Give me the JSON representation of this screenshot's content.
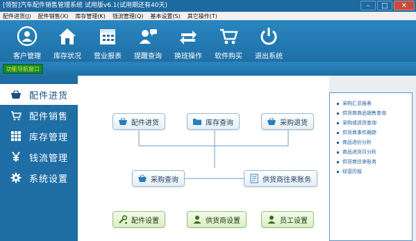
{
  "window": {
    "title": "[领智]汽车配件销售管理系统 试用版v6.1(试用期还有40天)",
    "controls": [
      "–",
      "□",
      "✕"
    ]
  },
  "menu": [
    "配件进货(J)",
    "配件销售(X)",
    "库存管理(K)",
    "钱流管理(Q)",
    "基本设置(S)",
    "其它操作(T)"
  ],
  "toolbar": [
    {
      "label": "客户管理",
      "icon": "customer-icon"
    },
    {
      "label": "库存状况",
      "icon": "home-icon"
    },
    {
      "label": "营业报表",
      "icon": "calendar-icon"
    },
    {
      "label": "提醒查询",
      "icon": "reminder-icon"
    },
    {
      "label": "换班操作",
      "icon": "swap-icon"
    },
    {
      "label": "软件购买",
      "icon": "cart-icon"
    },
    {
      "label": "退出系统",
      "icon": "power-icon"
    }
  ],
  "nav_tab": "功能导航窗口",
  "sidebar": [
    {
      "label": "配件进货",
      "icon": "basket-icon"
    },
    {
      "label": "配件销售",
      "icon": "cart-icon"
    },
    {
      "label": "库存管理",
      "icon": "grid-icon"
    },
    {
      "label": "钱流管理",
      "icon": "yen-icon"
    },
    {
      "label": "系统设置",
      "icon": "gear-icon"
    }
  ],
  "flow": {
    "parts_purchase": "配件进货",
    "stock_query": "库存查询",
    "purchase_return": "采购退货",
    "purchase_query": "采购查询",
    "supplier_account": "供货商往来账务",
    "parts_setup": "配件设置",
    "supplier_setup": "供货商设置",
    "staff_setup": "员工设置"
  },
  "quick_links": [
    "采购汇总报表",
    "供货商商品销售查询",
    "采购或退货查询",
    "供货商事件跟踪",
    "商品进价分析",
    "商品进货月分析",
    "供货商往来账务",
    "经营历程"
  ],
  "colors": {
    "brand": "#1f6ea5",
    "active": "#ffffff",
    "link": "#1e5aa0",
    "nav_tab": "#0d8c2a"
  }
}
